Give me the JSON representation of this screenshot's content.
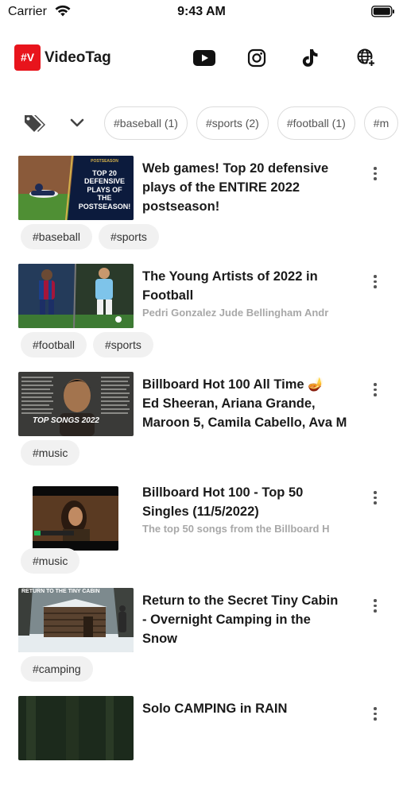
{
  "status_bar": {
    "carrier": "Carrier",
    "time": "9:43 AM"
  },
  "header": {
    "logo_badge": "#V",
    "app_title": "VideoTag"
  },
  "tag_filter": {
    "chips": [
      "#baseball (1)",
      "#sports (2)",
      "#football (1)",
      "#m"
    ]
  },
  "videos": [
    {
      "title_lines": [
        "Web games! Top 20 defensive",
        "plays of the ENTIRE 2022",
        "postseason!"
      ],
      "subtitle": "",
      "tags": [
        "#baseball",
        "#sports"
      ],
      "thumb_text": [
        "POSTSEASON",
        "TOP 20",
        "DEFENSIVE",
        "PLAYS OF",
        "THE",
        "POSTSEASON!"
      ]
    },
    {
      "title_lines": [
        "The Young Artists of 2022 in",
        "Football"
      ],
      "subtitle": "Pedri Gonzalez Jude Bellingham Andr",
      "tags": [
        "#football",
        "#sports"
      ]
    },
    {
      "title_lines": [
        "Billboard Hot 100 All Time 🪔",
        "Ed Sheeran,  Ariana Grande,",
        "Maroon 5, Camila Cabello, Ava M"
      ],
      "subtitle": "",
      "tags": [
        "#music"
      ],
      "thumb_text": [
        "TOP SONGS 2022"
      ]
    },
    {
      "title_lines": [
        "Billboard Hot 100 - Top 50",
        "Singles (11/5/2022)"
      ],
      "subtitle": "The top 50 songs from the Billboard H",
      "tags": [
        "#music"
      ]
    },
    {
      "title_lines": [
        "Return to the Secret Tiny Cabin",
        "- Overnight Camping in the",
        "Snow"
      ],
      "subtitle": "",
      "tags": [
        "#camping"
      ],
      "thumb_text": [
        "RETURN TO THE TINY CABIN"
      ]
    },
    {
      "title_lines": [
        "Solo CAMPING in RAIN"
      ],
      "subtitle": "",
      "tags": []
    }
  ],
  "icons": {
    "wifi": "wifi-icon",
    "battery": "battery-icon",
    "youtube": "youtube-icon",
    "instagram": "instagram-icon",
    "tiktok": "tiktok-icon",
    "web": "globe-plus-icon",
    "tags": "tags-icon",
    "expand": "chevron-down-icon",
    "more": "more-vertical-icon"
  },
  "colors": {
    "brand": "#e8141c",
    "chip_border": "#dcdcdc",
    "tag_bg": "#f1f1f1"
  }
}
